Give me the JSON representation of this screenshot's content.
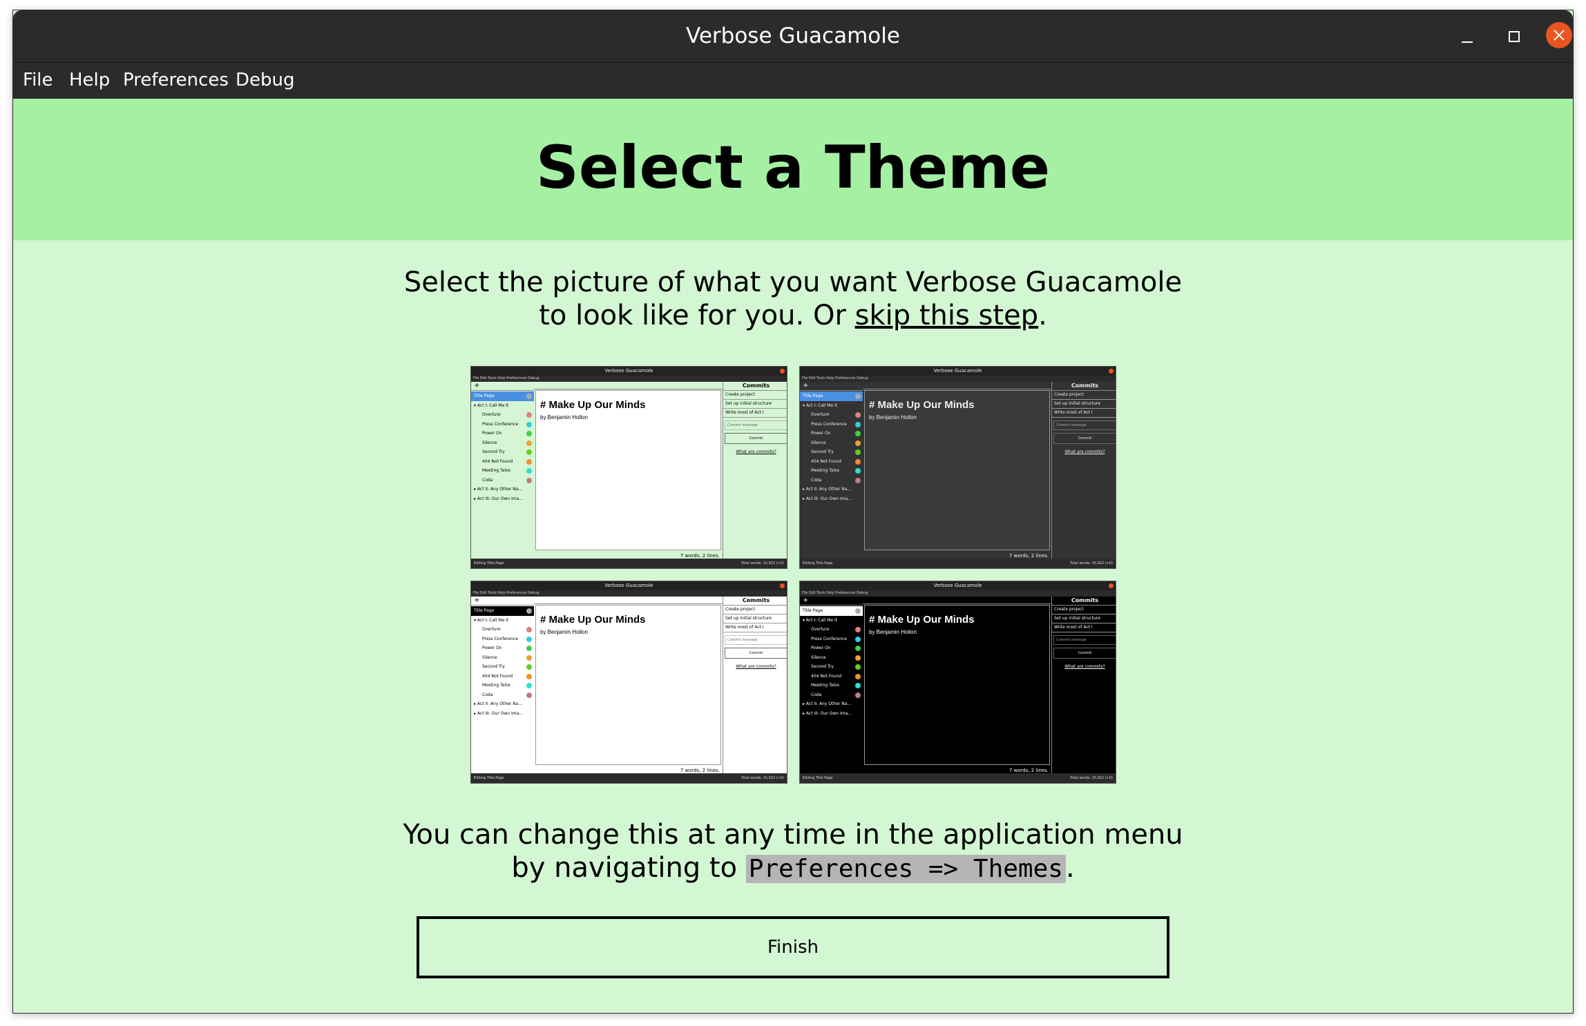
{
  "window": {
    "title": "Verbose Guacamole",
    "controls": [
      "minimize-icon",
      "maximize-icon",
      "close-icon"
    ],
    "close_color": "#e95420"
  },
  "menu": [
    {
      "label": "File"
    },
    {
      "label": "Help"
    },
    {
      "label": "Preferences"
    },
    {
      "label": "Debug"
    }
  ],
  "header": {
    "title": "Select a Theme",
    "color": "#a6f0a4"
  },
  "intro": {
    "line1": "Select the picture of what you want Verbose Guacamole",
    "line2_prefix": "to look like for you. Or ",
    "link": "skip this step",
    "line2_suffix": "."
  },
  "preview": {
    "app_title": "Verbose Guacamole",
    "menu": "File  Edit  Tools  Help  Preferences  Debug",
    "tree": [
      {
        "label": "Title Page",
        "color": "#aaaaaa"
      },
      {
        "label": "▾ Act I: Call Me It"
      },
      {
        "label": "Overture",
        "color": "#e08080"
      },
      {
        "label": "Press Conference",
        "color": "#30d0e0"
      },
      {
        "label": "Power On",
        "color": "#40d040"
      },
      {
        "label": "Silence",
        "color": "#f0a030"
      },
      {
        "label": "Second Try",
        "color": "#60d020"
      },
      {
        "label": "404 Not Found",
        "color": "#f09030"
      },
      {
        "label": "Meeting Talos",
        "color": "#30e0d0"
      },
      {
        "label": "Coda",
        "color": "#c08080"
      },
      {
        "label": "▸ Act II: Any Other Na..."
      },
      {
        "label": "▸ Act III: Our Own Ima..."
      }
    ],
    "heading": "# Make Up Our Minds",
    "byline": "by Benjamin Hollon",
    "word_count": "7 words, 2 lines.",
    "status": "Editing Title Page",
    "total": "Total words: 15,922 (+0)",
    "commits_title": "Commits",
    "commits": [
      "Create project",
      "Set up initial structure",
      "Write most of Act I"
    ],
    "commit_placeholder": "Commit message",
    "commit_button": "Commit",
    "commits_link": "What are commits?"
  },
  "themes": [
    {
      "id": "light-green",
      "name": "theme-light-green"
    },
    {
      "id": "dark",
      "name": "theme-dark"
    },
    {
      "id": "white",
      "name": "theme-white"
    },
    {
      "id": "black",
      "name": "theme-black"
    }
  ],
  "outro": {
    "line1": "You can change this at any time in the application menu",
    "line2_prefix": "by navigating to ",
    "code": "Preferences => Themes",
    "line2_suffix": "."
  },
  "finish_button": "Finish"
}
